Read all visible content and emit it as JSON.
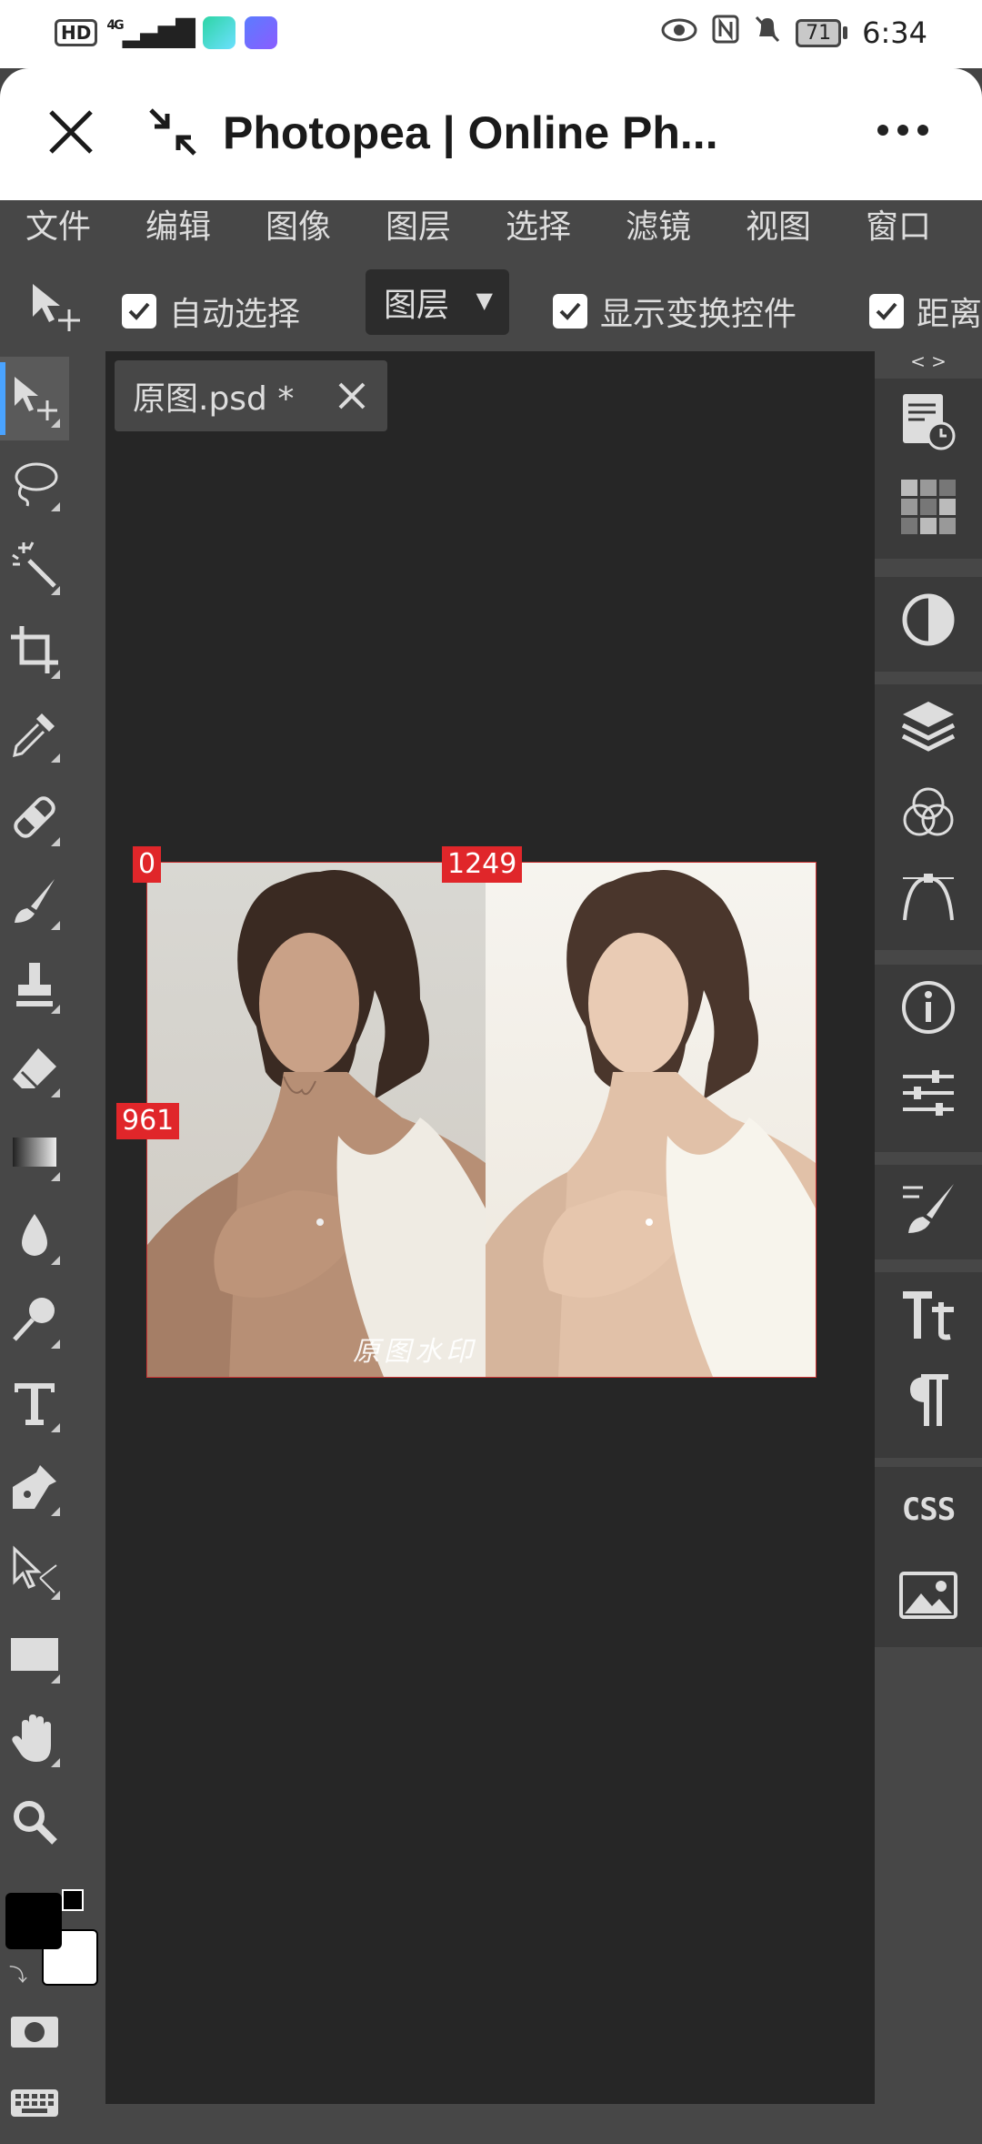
{
  "status_bar": {
    "left_badges": [
      "HD",
      "4G"
    ],
    "time": "6:34",
    "battery": "71"
  },
  "browser": {
    "title": "Photopea | Online Ph..."
  },
  "menu": {
    "items": [
      "文件",
      "编辑",
      "图像",
      "图层",
      "选择",
      "滤镜",
      "视图",
      "窗口"
    ]
  },
  "options": {
    "auto_select_label": "自动选择",
    "auto_select_checked": true,
    "target_dropdown": "图层",
    "show_transform_label": "显示变换控件",
    "show_transform_checked": true,
    "distance_label": "距离",
    "distance_checked": true
  },
  "document": {
    "tab_name": "原图.psd *"
  },
  "canvas": {
    "tag_origin": "0",
    "tag_x": "1249",
    "tag_y": "961",
    "watermark": "原图水印"
  },
  "panels": {
    "arrows": "< >",
    "css_label": "CSS"
  },
  "colors": {
    "accent": "#4aa3ff",
    "ruler_tag": "#e0262a",
    "ui_bg": "#474747",
    "canvas_bg": "#262626",
    "panel_bg": "#3a3a3a"
  },
  "icons": {
    "tools": [
      "move-tool-icon",
      "lasso-icon",
      "magic-wand-icon",
      "crop-icon",
      "eyedropper-icon",
      "healing-brush-icon",
      "brush-icon",
      "stamp-icon",
      "eraser-icon",
      "gradient-icon",
      "blur-icon",
      "dodge-icon",
      "type-tool-icon",
      "pen-icon",
      "direct-select-icon",
      "rectangle-icon",
      "hand-icon",
      "zoom-icon",
      "quick-mask-icon",
      "keyboard-icon"
    ],
    "panels": [
      "history-icon",
      "swatches-icon",
      "adjustments-icon",
      "layers-icon",
      "channels-icon",
      "paths-icon",
      "info-icon",
      "properties-icon",
      "brushes-icon",
      "character-icon",
      "paragraph-icon",
      "css-icon",
      "image-icon"
    ]
  }
}
